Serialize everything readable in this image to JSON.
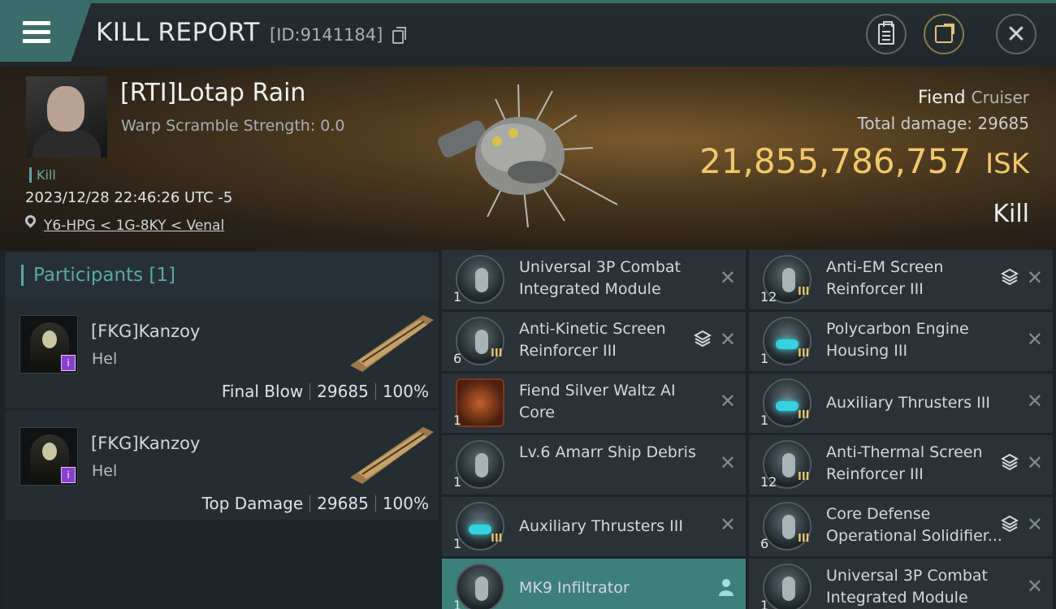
{
  "header": {
    "title": "KILL REPORT",
    "report_id": "[ID:9141184]"
  },
  "victim": {
    "name": "[RTI]Lotap Rain",
    "warp_scramble": "Warp Scramble Strength: 0.0",
    "tag": "Kill",
    "datetime": "2023/12/28 22:46:26 UTC -5",
    "location": "Y6-HPG < 1G-8KY < Venal",
    "ship_name": "Fiend",
    "ship_class": "Cruiser",
    "total_damage_label": "Total damage:",
    "total_damage": "29685",
    "isk_value": "21,855,786,757",
    "isk_unit": "ISK",
    "result": "Kill"
  },
  "participants": {
    "title": "Participants [1]",
    "list": [
      {
        "name": "[FKG]Kanzoy",
        "ship": "Hel",
        "role": "Final Blow",
        "damage": "29685",
        "percent": "100%"
      },
      {
        "name": "[FKG]Kanzoy",
        "ship": "Hel",
        "role": "Top Damage",
        "damage": "29685",
        "percent": "100%"
      }
    ]
  },
  "items": [
    {
      "label": "Universal 3P Combat Integrated Module",
      "qty": "1",
      "tier": ""
    },
    {
      "label": "Anti-EM Screen Reinforcer III",
      "qty": "12",
      "tier": "III"
    },
    {
      "label": "Anti-Kinetic Screen Reinforcer III",
      "qty": "6",
      "tier": "III"
    },
    {
      "label": "Polycarbon Engine Housing III",
      "qty": "1",
      "tier": "III"
    },
    {
      "label": "Fiend Silver Waltz AI Core",
      "qty": "1",
      "tier": ""
    },
    {
      "label": "Auxiliary Thrusters III",
      "qty": "1",
      "tier": "III"
    },
    {
      "label": "Lv.6 Amarr Ship Debris",
      "qty": "1",
      "tier": ""
    },
    {
      "label": "Anti-Thermal Screen Reinforcer III",
      "qty": "12",
      "tier": "III"
    },
    {
      "label": "Auxiliary Thrusters III",
      "qty": "1",
      "tier": "III"
    },
    {
      "label": "Core Defense Operational Solidifier...",
      "qty": "6",
      "tier": "III"
    },
    {
      "label": "MK9 Infiltrator",
      "qty": "1",
      "tier": ""
    },
    {
      "label": "Universal 3P Combat Integrated Module",
      "qty": "1",
      "tier": ""
    }
  ],
  "icons": {
    "close_glyph": "✕",
    "stack": "stack-icon",
    "pilot": "pilot-icon",
    "location": "location-pin-icon"
  },
  "colors": {
    "accent_teal": "#3c6c69",
    "isk_gold": "#f0c86c",
    "selected_row": "#3d7f7d",
    "tier_gold": "#e5c56c"
  }
}
